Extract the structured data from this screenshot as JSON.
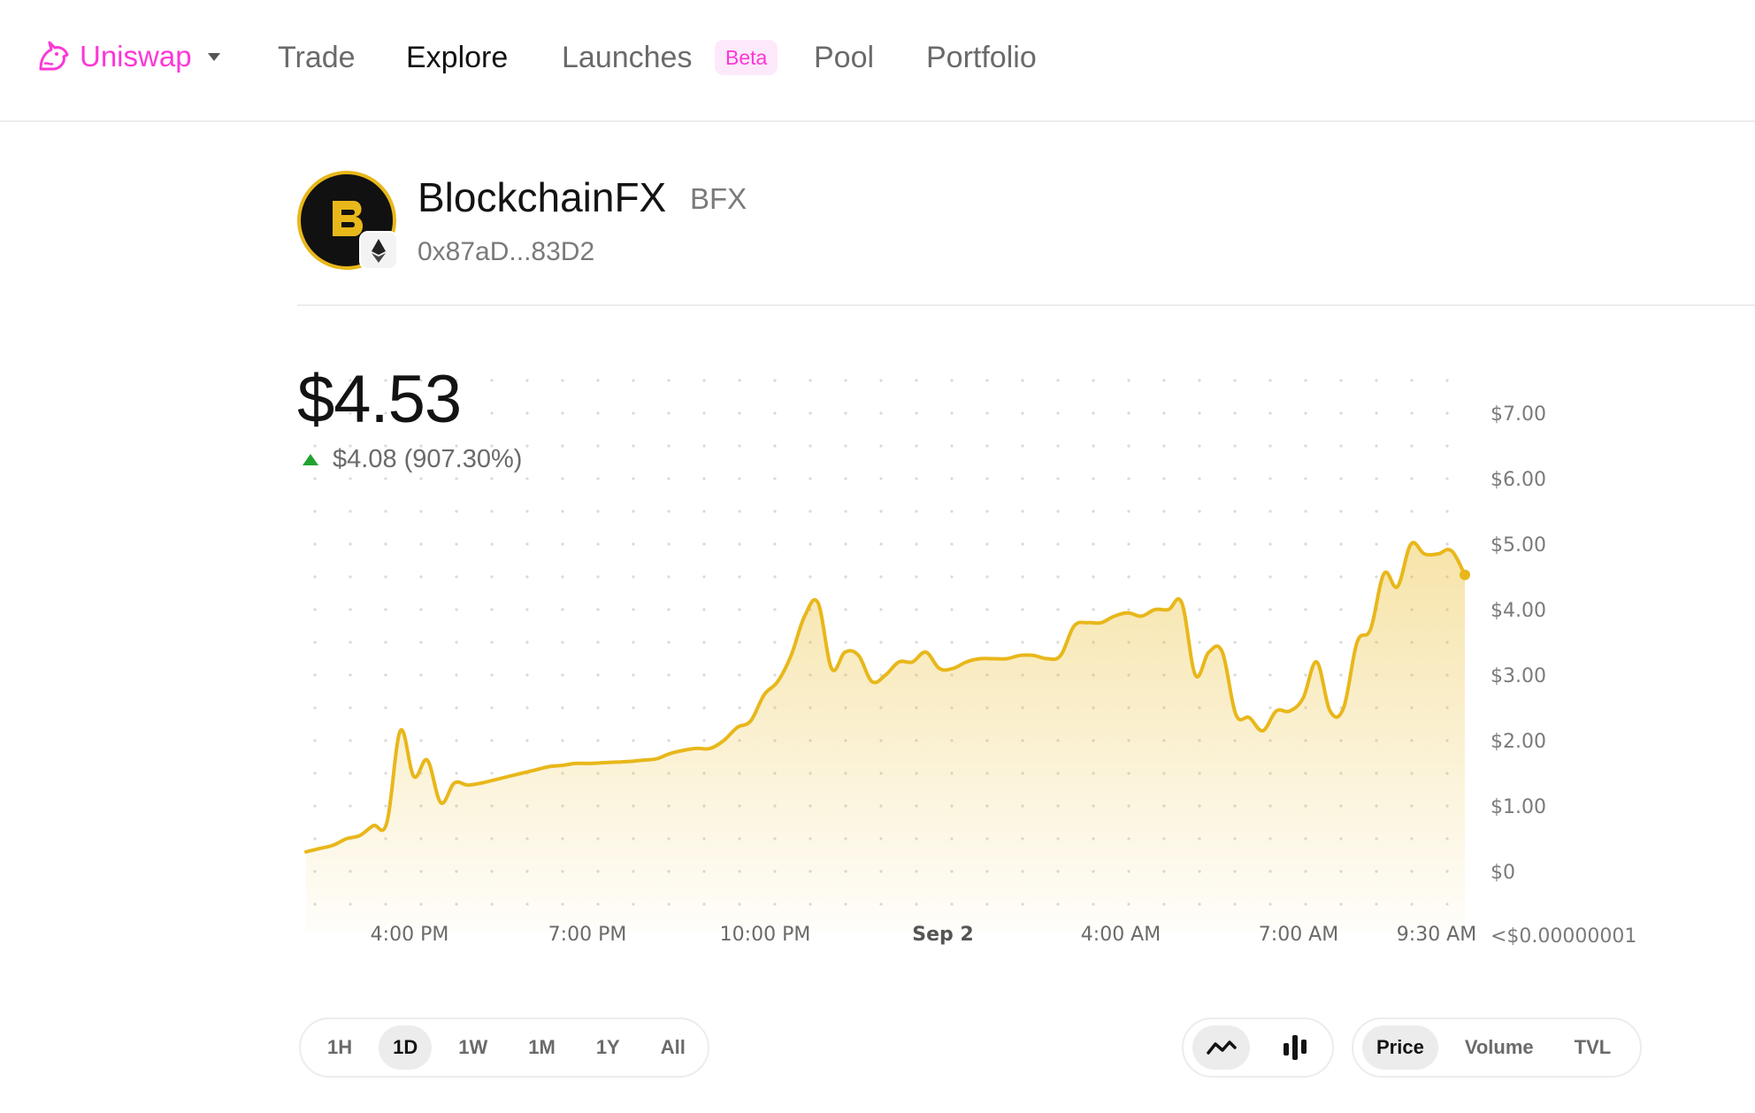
{
  "nav": {
    "brand": "Uniswap",
    "items": [
      {
        "label": "Trade"
      },
      {
        "label": "Explore"
      },
      {
        "label": "Launches"
      },
      {
        "label": "Pool"
      },
      {
        "label": "Portfolio"
      }
    ],
    "badge": "Beta"
  },
  "token": {
    "name": "BlockchainFX",
    "symbol": "BFX",
    "address": "0x87aD...83D2",
    "logo_color": "#e8b71a"
  },
  "price": {
    "current": "$4.53",
    "change": "$4.08 (907.30%)",
    "direction": "up",
    "up_color": "#21a32f"
  },
  "chart_data": {
    "type": "area",
    "line_color": "#e8b71a",
    "y_ticks": [
      "$7.00",
      "$6.00",
      "$5.00",
      "$4.00",
      "$3.00",
      "$2.00",
      "$1.00",
      "$0",
      "<$0.00000001"
    ],
    "x_ticks": [
      "4:00 PM",
      "7:00 PM",
      "10:00 PM",
      "Sep 2",
      "4:00 AM",
      "7:00 AM",
      "9:30 AM"
    ],
    "ylim": [
      0,
      7
    ],
    "grid": "dotted",
    "values": [
      0.3,
      0.35,
      0.4,
      0.5,
      0.55,
      0.7,
      0.75,
      2.15,
      1.45,
      1.7,
      1.05,
      1.35,
      1.32,
      1.35,
      1.4,
      1.45,
      1.5,
      1.55,
      1.6,
      1.62,
      1.65,
      1.65,
      1.66,
      1.67,
      1.68,
      1.7,
      1.72,
      1.8,
      1.85,
      1.88,
      1.88,
      2.0,
      2.2,
      2.3,
      2.7,
      2.9,
      3.3,
      3.9,
      4.1,
      3.1,
      3.35,
      3.3,
      2.9,
      3.0,
      3.2,
      3.2,
      3.35,
      3.1,
      3.1,
      3.2,
      3.25,
      3.25,
      3.25,
      3.3,
      3.3,
      3.25,
      3.3,
      3.75,
      3.8,
      3.8,
      3.9,
      3.95,
      3.9,
      4.0,
      4.0,
      4.1,
      3.0,
      3.35,
      3.35,
      2.4,
      2.35,
      2.15,
      2.45,
      2.45,
      2.65,
      3.2,
      2.45,
      2.5,
      3.5,
      3.7,
      4.55,
      4.35,
      5.0,
      4.85,
      4.85,
      4.9,
      4.53
    ],
    "last_value": 4.53
  },
  "controls": {
    "time_ranges": [
      "1H",
      "1D",
      "1W",
      "1M",
      "1Y",
      "All"
    ],
    "active_time_range": "1D",
    "chart_types": [
      "line-chart-icon",
      "candlestick-icon"
    ],
    "active_chart_type": "line-chart-icon",
    "metrics": [
      "Price",
      "Volume",
      "TVL"
    ],
    "active_metric": "Price"
  }
}
